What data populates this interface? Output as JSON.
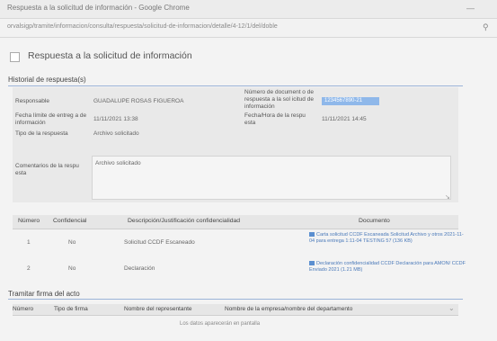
{
  "browser": {
    "title": "Respuesta a la solicitud de información - Google Chrome",
    "url": "orvalsigp/tramite/informacion/consulta/respuesta/solicitud-de-informacion/detalle/4-12/1/del/doble",
    "minimize_glyph": "—",
    "extension_icon": "key-icon"
  },
  "page": {
    "title": "Respuesta a la solicitud de información",
    "history_heading": "Historial de respuesta(s)",
    "fields": {
      "responsable_label": "Responsable",
      "responsable_value": "GUADALUPE ROSAS FIGUEROA",
      "numero_label": "Número de document o de respuesta a la sol icitud de información",
      "numero_value": "1234567890-21",
      "fecha_entrega_label": "Fecha límite de entreg a de información",
      "fecha_entrega_value": "11/11/2021 13:38",
      "fecha_respuesta_label": "Fecha/Hora de la respu esta",
      "fecha_respuesta_value": "11/11/2021 14:45",
      "tipo_respuesta_label": "Tipo de la respuesta",
      "tipo_respuesta_value": "Archivo solicitado",
      "comentarios_label": "Comentarios de la respu esta",
      "comentarios_value": "Archivo solicitado"
    },
    "resize_glyph": "↘"
  },
  "table": {
    "headers": [
      "Número",
      "Confidencial",
      "Descripción/Justificación confidencialidad",
      "Documento"
    ],
    "rows": [
      {
        "num": "1",
        "conf": "No",
        "desc": "Solicitud CCDF Escaneado",
        "doc": "Carta solicitud CCDF Escaneada Solicitud Archivo y otros 2021-11-04 para entrega 1:11-04 TESTING 57 (136 KB)"
      },
      {
        "num": "2",
        "conf": "No",
        "desc": "Declaración",
        "doc": "Declaración confidencialidad CCDF Declaración para AMON/ CCDF Enviado 2021 (1.21 MB)"
      }
    ]
  },
  "firmas": {
    "heading": "Tramitar firma del acto",
    "headers": [
      "Número",
      "Tipo de firma",
      "Nombre del representante",
      "Nombre de la empresa/nombre del departamento"
    ],
    "dropdown_glyph": "⌄",
    "empty_text": "Los datos aparecerán en pantalla"
  }
}
